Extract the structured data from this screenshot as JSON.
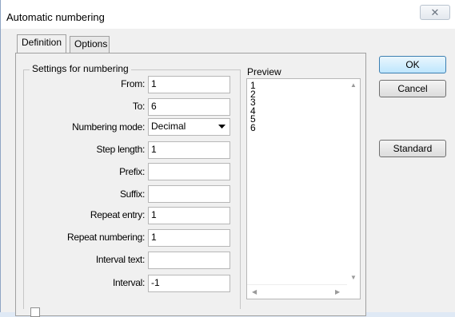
{
  "window": {
    "title": "Automatic numbering",
    "close_glyph": "✕"
  },
  "tabs": [
    {
      "label": "Definition"
    },
    {
      "label": "Options"
    }
  ],
  "settings": {
    "group_label": "Settings for numbering",
    "from": {
      "label": "From:",
      "value": "1"
    },
    "to": {
      "label": "To:",
      "value": "6"
    },
    "mode": {
      "label": "Numbering mode:",
      "value": "Decimal"
    },
    "step": {
      "label": "Step length:",
      "value": "1"
    },
    "prefix": {
      "label": "Prefix:",
      "value": ""
    },
    "suffix": {
      "label": "Suffix:",
      "value": ""
    },
    "repeat_entry": {
      "label": "Repeat entry:",
      "value": "1"
    },
    "repeat_numbering": {
      "label": "Repeat numbering:",
      "value": "1"
    },
    "interval_text": {
      "label": "Interval text:",
      "value": ""
    },
    "interval": {
      "label": "Interval:",
      "value": "-1"
    }
  },
  "preview": {
    "label": "Preview",
    "lines": [
      "1",
      "2",
      "3",
      "4",
      "5",
      "6"
    ]
  },
  "buttons": {
    "ok": "OK",
    "cancel": "Cancel",
    "standard": "Standard"
  }
}
